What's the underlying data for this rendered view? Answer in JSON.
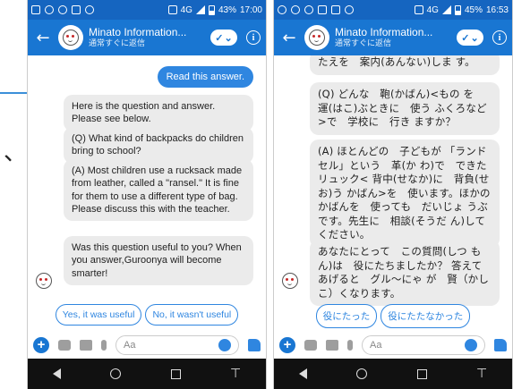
{
  "left_phone": {
    "status": {
      "signal": "4G",
      "battery": "43%",
      "time": "17:00"
    },
    "header": {
      "title": "Minato Information...",
      "subtitle": "通常すぐに返信"
    },
    "outgoing": "Read this answer.",
    "messages": [
      "Here is the question and answer. Please see below.",
      "(Q) What kind of backpacks do children bring to school?",
      "(A) Most children use a rucksack made from leather, called a \"ransel.\" It is fine for them to use a different type of bag. Please discuss this with the teacher.",
      "Was this question useful to you? When you answer,Guroonya will become smarter!"
    ],
    "quick_replies": [
      "Yes, it was useful",
      "No, it wasn't useful"
    ],
    "composer": {
      "placeholder": "Aa"
    }
  },
  "right_phone": {
    "status": {
      "signal": "4G",
      "battery": "45%",
      "time": "16:53"
    },
    "header": {
      "title": "Minato Information...",
      "subtitle": "通常すぐに返信"
    },
    "messages": [
      "たえを　案内(あんない)しま す。",
      "(Q) どんな　鞄(かばん)<もの を　運(はこ)ぶときに　使う ふくろなど>で　学校に　行き ますか？",
      "(A) ほとんどの　子どもが 「ランドセル」という　革(か わ)で　できた　リュック< 背中(せなか)に　背負(せお)う かばん>を　使います。ほかの かばんを　使っても　だいじょ うぶです。先生に　相談(そうだ ん)して　ください。",
      "あなたにとって　この質問(しつ もん)は　役にたちましたか？ 答えて　あげると　グル～にゃ が　賢（かしこ）くなります。"
    ],
    "quick_replies": [
      "役にたった",
      "役にたたなかった"
    ],
    "composer": {
      "placeholder": "Aa"
    }
  },
  "annotation": {
    "mark": "、"
  },
  "colors": {
    "header": "#1976d2",
    "statusbar": "#1565c0",
    "accent": "#2f86e0",
    "bubble": "#ebebeb"
  }
}
